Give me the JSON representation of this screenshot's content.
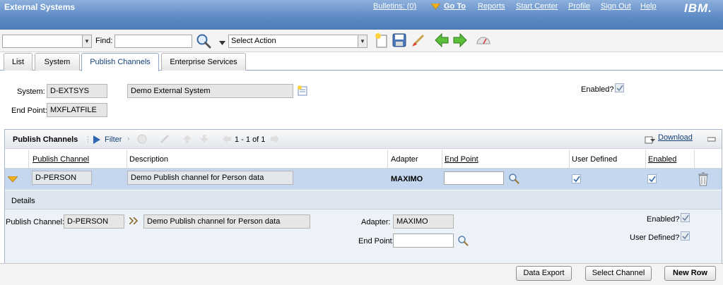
{
  "app": {
    "title": "External Systems",
    "nav": {
      "bulletins": "Bulletins: (0)",
      "goto": "Go To",
      "reports": "Reports",
      "start_center": "Start Center",
      "profile": "Profile",
      "sign_out": "Sign Out",
      "help": "Help"
    },
    "logo": "IBM."
  },
  "toolbar": {
    "find_label": "Find:",
    "find_value": "",
    "select_action": "Select Action"
  },
  "tabs": [
    "List",
    "System",
    "Publish Channels",
    "Enterprise Services"
  ],
  "active_tab": "Publish Channels",
  "header": {
    "system_label": "System:",
    "system_value": "D-EXTSYS",
    "system_desc": "Demo External System",
    "endpoint_label": "End Point:",
    "endpoint_value": "MXFLATFILE",
    "enabled_label": "Enabled?"
  },
  "section": {
    "title": "Publish Channels",
    "filter": "Filter",
    "paging": "1 - 1 of 1",
    "download": "Download",
    "columns": [
      "Publish Channel",
      "Description",
      "Adapter",
      "End Point",
      "User Defined",
      "Enabled"
    ],
    "rows": [
      {
        "publish_channel": "D-PERSON",
        "description": "Demo Publish channel for Person data",
        "adapter": "MAXIMO",
        "end_point": "",
        "user_defined": true,
        "enabled": true
      }
    ]
  },
  "details": {
    "title": "Details",
    "publish_channel_label": "Publish Channel:",
    "publish_channel_value": "D-PERSON",
    "description_value": "Demo Publish channel for Person data",
    "adapter_label": "Adapter:",
    "adapter_value": "MAXIMO",
    "endpoint_label": "End Point:",
    "endpoint_value": "",
    "enabled_label": "Enabled?",
    "user_defined_label": "User Defined?"
  },
  "buttons": {
    "data_export": "Data Export",
    "select_channel": "Select Channel",
    "new_row": "New Row"
  },
  "colors": {
    "titlebar": "#5f8cc6",
    "selected_row": "#c5d7ee",
    "details_bg": "#edf2f8",
    "link": "#15407a"
  }
}
